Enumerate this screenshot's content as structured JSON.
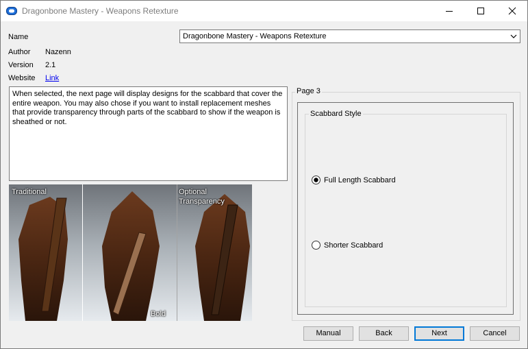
{
  "window": {
    "title": "Dragonbone Mastery - Weapons Retexture",
    "icon": "package-icon"
  },
  "fields": {
    "name_label": "Name",
    "name_value": "Dragonbone Mastery - Weapons Retexture",
    "author_label": "Author",
    "author_value": "Nazenn",
    "version_label": "Version",
    "version_value": "2.1",
    "website_label": "Website",
    "website_link": "Link"
  },
  "description": "When selected, the next page will display designs for the scabbard that cover the entire weapon. You may also chose if you want to install replacement meshes that provide transparency through parts of the scabbard to show if the weapon is sheathed or not.",
  "preview": {
    "captions": {
      "left": "Traditional",
      "right_line1": "Optional",
      "right_line2": "Transparency",
      "bottom_center": "Bold"
    }
  },
  "page": {
    "title": "Page 3",
    "group_title": "Scabbard Style",
    "options": [
      {
        "label": "Full Length Scabbard",
        "selected": true
      },
      {
        "label": "Shorter Scabbard",
        "selected": false
      }
    ]
  },
  "buttons": {
    "manual": "Manual",
    "back": "Back",
    "next": "Next",
    "cancel": "Cancel"
  },
  "colors": {
    "accent": "#0078d7",
    "link": "#0000ee"
  }
}
